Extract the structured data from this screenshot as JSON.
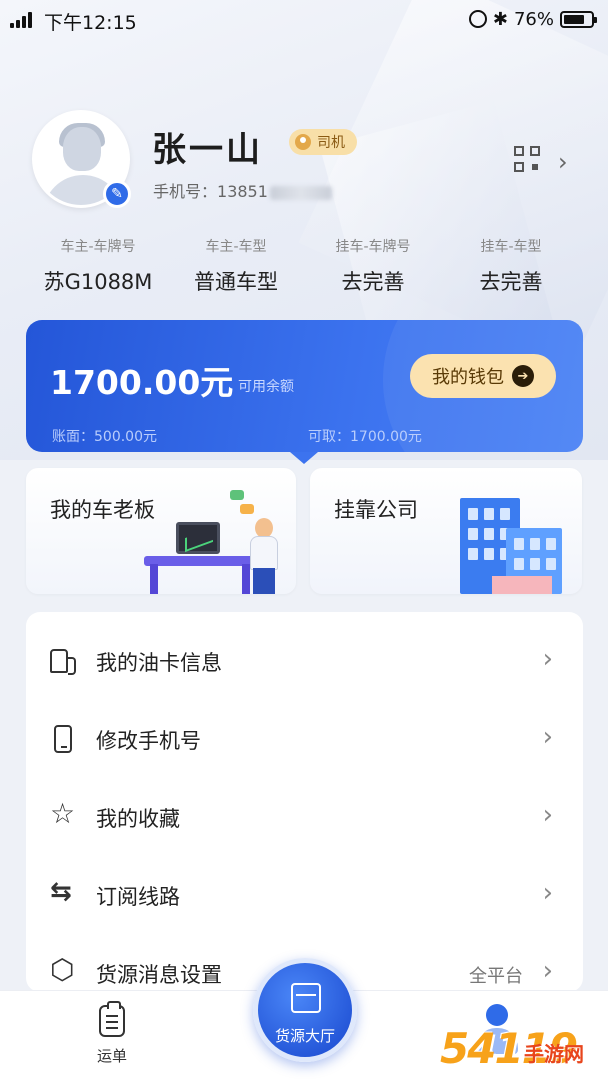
{
  "status_bar": {
    "time": "下午12:15",
    "battery": "76%"
  },
  "profile": {
    "name": "张一山",
    "role": "司机",
    "phone_label": "手机号：",
    "phone_visible": "13851"
  },
  "vehicle": [
    {
      "label": "车主-车牌号",
      "value": "苏G1088M"
    },
    {
      "label": "车主-车型",
      "value": "普通车型"
    },
    {
      "label": "挂车-车牌号",
      "value": "去完善"
    },
    {
      "label": "挂车-车型",
      "value": "去完善"
    }
  ],
  "wallet": {
    "balance": "1700.00元",
    "balance_label": "可用余额",
    "button_label": "我的钱包",
    "account": "账面：500.00元",
    "available": "可取：1700.00元"
  },
  "cards": {
    "boss": "我的车老板",
    "company": "挂靠公司"
  },
  "menu": [
    {
      "label": "我的油卡信息",
      "icon": "fuel-card-icon"
    },
    {
      "label": "修改手机号",
      "icon": "mobile-phone-icon"
    },
    {
      "label": "我的收藏",
      "icon": "star-icon"
    },
    {
      "label": "订阅线路",
      "icon": "route-icon"
    },
    {
      "label": "货源消息设置",
      "icon": "settings-hex-icon",
      "extra": "全平台"
    }
  ],
  "nav": {
    "orders": "运单",
    "cargo_hall": "货源大厅",
    "me": ""
  },
  "watermark": {
    "num": "54119",
    "text": "手游网"
  },
  "colors": {
    "accent_blue": "#2456d8",
    "wallet_button": "#fbe2b0",
    "role_badge": "#f8dfa8"
  }
}
